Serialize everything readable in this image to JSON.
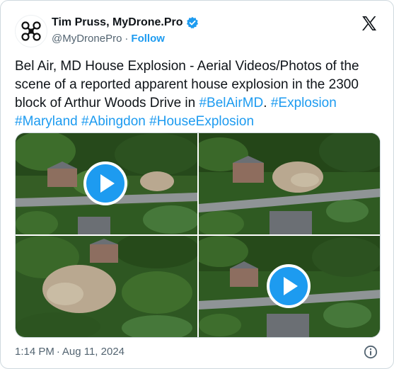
{
  "author": {
    "name": "Tim Pruss, MyDrone.Pro",
    "handle": "@MyDronePro",
    "separator": "·",
    "follow_label": "Follow",
    "avatar_icon": "drone-icon",
    "verified_icon": "verified-badge-icon"
  },
  "brand_icon": "x-logo-icon",
  "tweet": {
    "text_plain": "Bel Air, MD House Explosion - Aerial Videos/Photos of the scene of a reported apparent house explosion in the 2300 block of Arthur Woods Drive in ",
    "hashtags": [
      "#BelAirMD",
      "#Explosion",
      "#Maryland",
      "#Abingdon",
      "#HouseExplosion"
    ],
    "period": "."
  },
  "media": [
    {
      "kind": "video",
      "play_icon": "play-icon"
    },
    {
      "kind": "photo"
    },
    {
      "kind": "photo"
    },
    {
      "kind": "video",
      "play_icon": "play-icon"
    }
  ],
  "footer": {
    "time": "1:14 PM",
    "separator": "·",
    "date": "Aug 11, 2024",
    "info_icon": "info-icon"
  },
  "colors": {
    "accent": "#1d9bf0",
    "text": "#0f1419",
    "muted": "#536471",
    "border": "#cfd9de",
    "foliage": "#2f5a22",
    "road": "#8f9496",
    "roof": "#6b6f74",
    "debris": "#b9a890"
  }
}
